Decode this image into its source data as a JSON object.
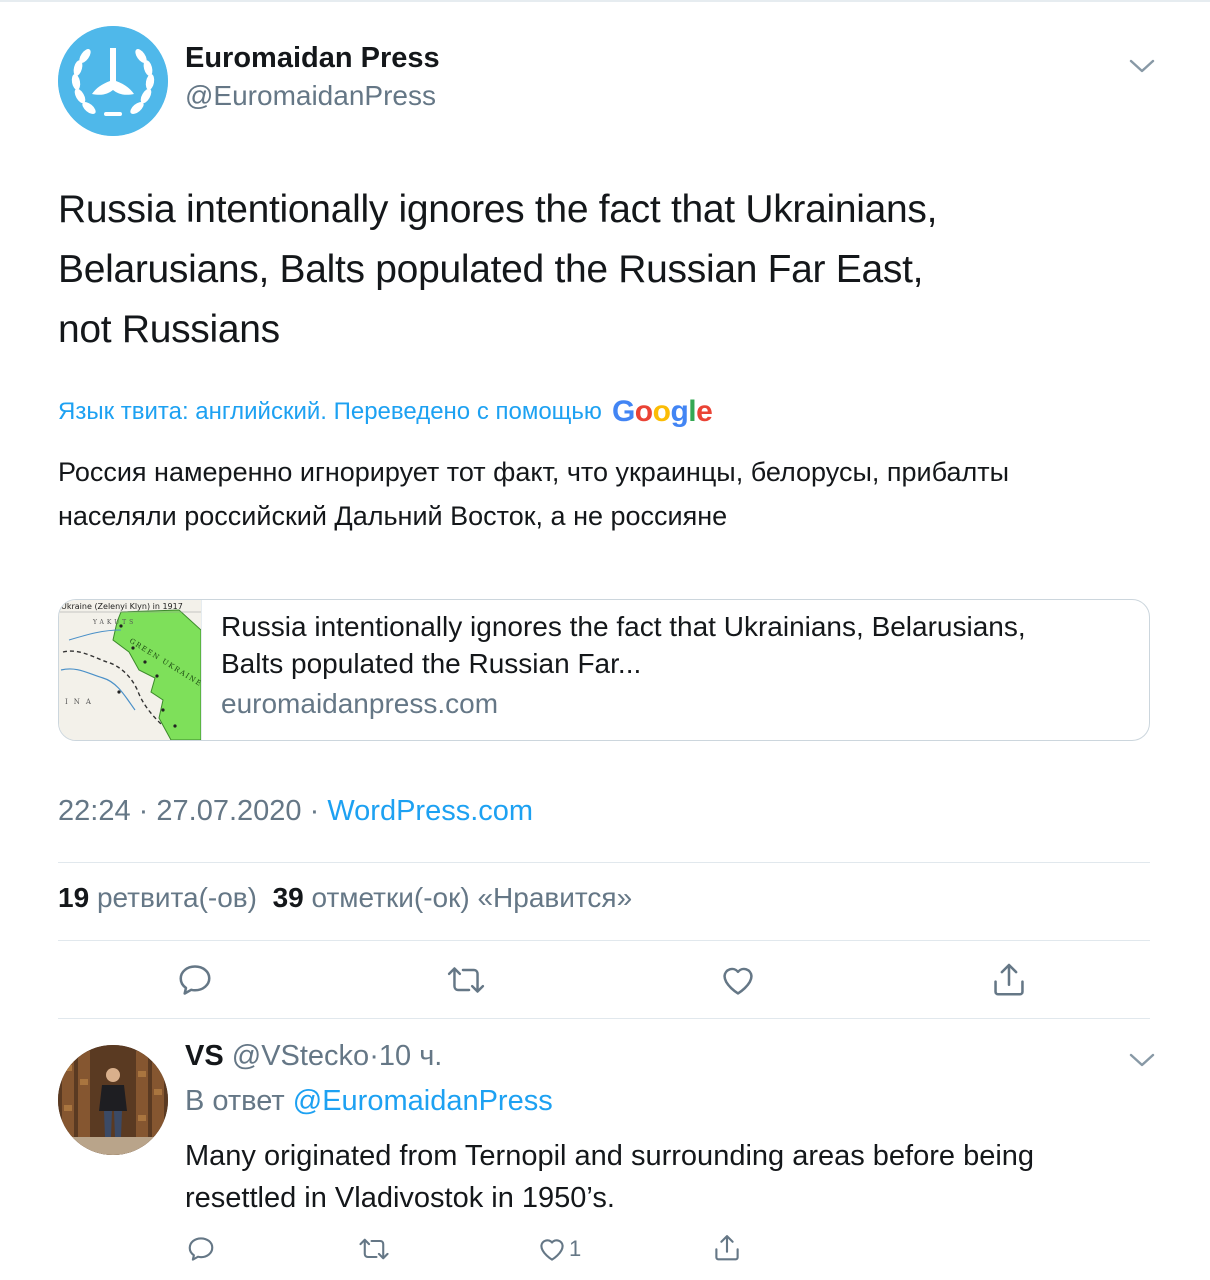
{
  "tweet": {
    "author": {
      "name": "Euromaidan Press",
      "handle": "@EuromaidanPress"
    },
    "text": "Russia intentionally ignores the fact that Ukrainians,\nBelarusians, Balts populated the Russian Far East,\nnot Russians",
    "translation": {
      "label": "Язык твита: английский. Переведено с помощью",
      "provider": "Google",
      "text": "Россия намеренно игнорирует тот факт, что украинцы, белорусы, прибалты\nнаселяли российский Дальний Восток, а не россияне"
    },
    "link_card": {
      "thumbnail_caption": "Ukraine (Zelenyi Klyn) in 1917",
      "map_labels": [
        "YAKUTS",
        "GREEN UKRAINE",
        "INA"
      ],
      "title": "Russia intentionally ignores the fact that Ukrainians, Belarusians,\nBalts populated the Russian Far...",
      "domain": "euromaidanpress.com"
    },
    "time": "22:24",
    "date": "27.07.2020",
    "separator": "·",
    "source": "WordPress.com",
    "stats": {
      "retweets_count": "19",
      "retweets_label": "ретвита(-ов)",
      "likes_count": "39",
      "likes_label": "отметки(-ок) «Нравится»"
    },
    "actions": {
      "reply_icon": "reply-icon",
      "retweet_icon": "retweet-icon",
      "like_icon": "heart-icon",
      "share_icon": "share-icon"
    }
  },
  "reply": {
    "name": "VS",
    "handle": "@VStecko",
    "separator": "·",
    "age": "10 ч.",
    "reply_prefix": "В ответ",
    "reply_to": "@EuromaidanPress",
    "text": "Many originated from Ternopil and surrounding areas before being\nresettled in Vladivostok in 1950’s.",
    "like_count": "1"
  },
  "colors": {
    "link_blue": "#1da1f2",
    "muted_gray": "#657786",
    "text_dark": "#14171a",
    "avatar_blue": "#4fb8ea",
    "map_green": "#7ee05a"
  }
}
